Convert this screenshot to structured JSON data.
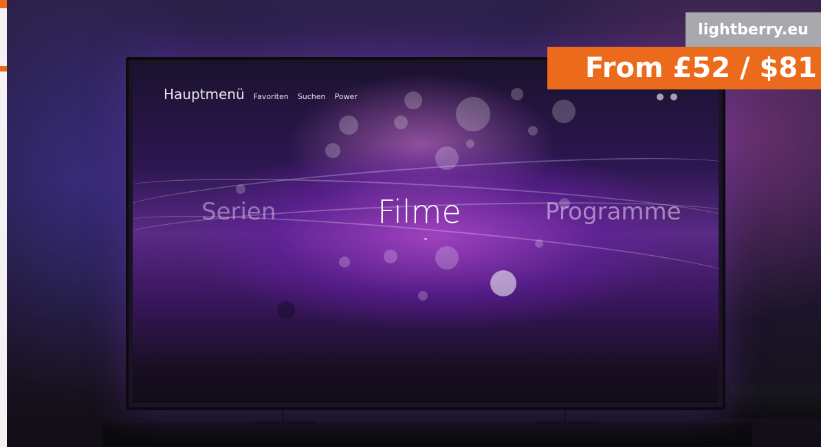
{
  "tv_menu": {
    "main_title": "Hauptmenü",
    "items": [
      "Favoriten",
      "Suchen",
      "Power"
    ],
    "categories": {
      "left": "Serien",
      "center": "Filme",
      "right": "Programme"
    },
    "chevron": "⌄"
  },
  "badges": {
    "site": "lightberry.eu",
    "price": "From £52 / $81"
  },
  "colors": {
    "accent_orange": "#ec6a1b",
    "site_badge_gray": "#a9a8ac",
    "ambient_purple": "#7a3fb0"
  }
}
